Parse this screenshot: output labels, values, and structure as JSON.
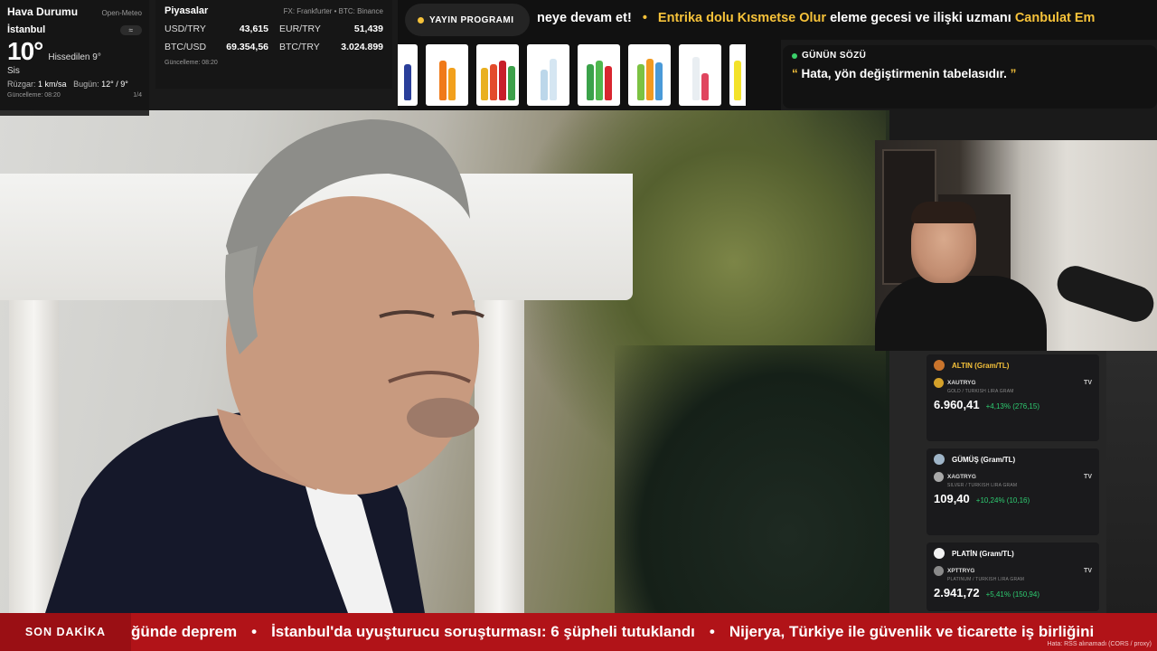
{
  "weather": {
    "title": "Hava Durumu",
    "source": "Open-Meteo",
    "city": "İstanbul",
    "icon": "≈",
    "temp": "10°",
    "feels": "Hissedilen 9°",
    "condition": "Sis",
    "wind_label": "Rüzgar:",
    "wind_value": "1 km/sa",
    "today_label": "Bugün:",
    "today_value": "12° / 9°",
    "updated": "Güncelleme: 08:20",
    "page": "1/4"
  },
  "markets": {
    "title": "Piyasalar",
    "source": "FX: Frankfurter • BTC: Binance",
    "rates": [
      {
        "pair": "USD/TRY",
        "value": "43,615"
      },
      {
        "pair": "EUR/TRY",
        "value": "51,439"
      },
      {
        "pair": "BTC/USD",
        "value": "69.354,56"
      },
      {
        "pair": "BTC/TRY",
        "value": "3.024.899"
      }
    ],
    "updated": "Güncelleme: 08:20"
  },
  "program": {
    "label": "YAYIN PROGRAMI"
  },
  "top_ticker": {
    "part1": "neye devam et!",
    "sep": "•",
    "part2_hl": "Entrika dolu Kısmetse Olur",
    "part2": " eleme gecesi ve ilişki uzmanı ",
    "part3_hl": "Canbulat Em"
  },
  "quote": {
    "title": "GÜNÜN SÖZÜ",
    "open_mark": "“",
    "text": "Hata, yön değiştirmenin tabelasıdır.",
    "close_mark": "”"
  },
  "metals": [
    {
      "title": "ALTIN (Gram/TL)",
      "symbol": "XAUTRYG",
      "subtitle": "GOLD / TURKISH LIRA GRAM",
      "price": "6.960,41",
      "change": "+4,13% (276,15)",
      "medal": "#c9742c",
      "coin": "#d4a12a"
    },
    {
      "title": "GÜMÜŞ (Gram/TL)",
      "symbol": "XAGTRYG",
      "subtitle": "SILVER / TURKISH LIRA GRAM",
      "price": "109,40",
      "change": "+10,24% (10,16)",
      "medal": "#9fb5c8",
      "coin": "#a8a8a8"
    },
    {
      "title": "PLATİN (Gram/TL)",
      "symbol": "XPTTRYG",
      "subtitle": "PLATINUM / TURKISH LIRA GRAM",
      "price": "2.941,72",
      "change": "+5,41% (150,94)",
      "medal": "#f2f2f2",
      "coin": "#8a8a8a"
    }
  ],
  "metal_tv": "TV",
  "breaking": {
    "label": "SON DAKİKA",
    "items": [
      "ğünde deprem",
      "İstanbul'da uyuşturucu soruşturması: 6 şüpheli tutuklandı",
      "Nijerya, Türkiye ile güvenlik ve ticarette iş birliğini"
    ],
    "sep": "•",
    "rss_note": "Hata: RSS alınamadı (CORS / proxy)"
  },
  "colors": {
    "accent": "#f6c23a",
    "breaking_red": "#b11318",
    "positive": "#2ecc71"
  }
}
